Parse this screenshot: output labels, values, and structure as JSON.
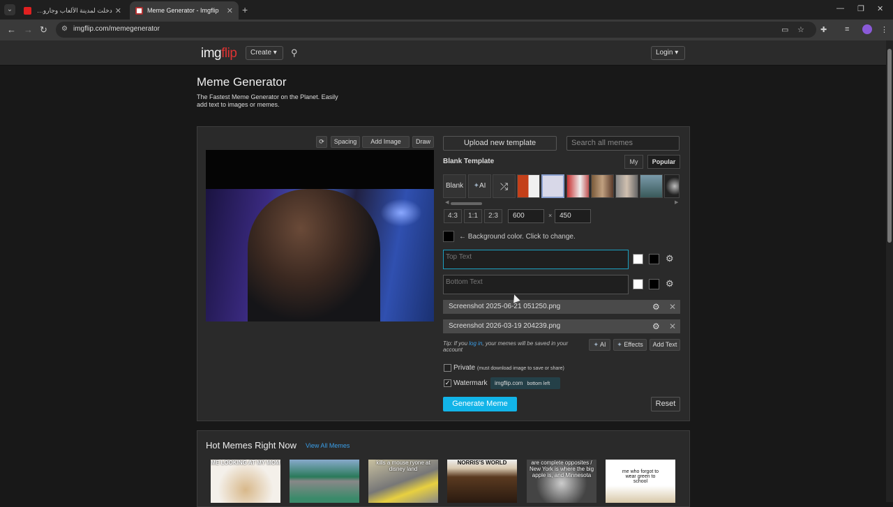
{
  "browser": {
    "tabs": [
      {
        "title": "دخلت لمدينة الألعاب وجارو ليا تتو..."
      },
      {
        "title": "Meme Generator - Imgflip"
      }
    ],
    "url": "imgflip.com/memegenerator"
  },
  "header": {
    "logo_main": "img",
    "logo_accent": "flip",
    "create_label": "Create ▾",
    "login_label": "Login ▾"
  },
  "page": {
    "title": "Meme Generator",
    "subtitle": "The Fastest Meme Generator on the Planet. Easily add text to images or memes."
  },
  "canvas_tools": {
    "spacing": "Spacing",
    "add_image": "Add Image",
    "draw": "Draw"
  },
  "templates": {
    "upload_label": "Upload new template",
    "search_placeholder": "Search all memes",
    "blank_template_label": "Blank Template",
    "tab_my": "My",
    "tab_popular": "Popular",
    "blank_thumb": "Blank",
    "ai_thumb": "AI"
  },
  "size": {
    "ratios": [
      "4:3",
      "1:1",
      "2:3"
    ],
    "width": "600",
    "height": "450",
    "x": "×"
  },
  "background": {
    "label": "← Background color. Click to change.",
    "color": "#000000"
  },
  "text_boxes": [
    {
      "placeholder": "Top Text"
    },
    {
      "placeholder": "Bottom Text"
    }
  ],
  "image_layers": [
    {
      "name": "Screenshot 2025-06-21 051250.png"
    },
    {
      "name": "Screenshot 2026-03-19 204239.png"
    }
  ],
  "tip": {
    "prefix": "Tip: If you ",
    "link": "log in",
    "suffix": ", your memes will be saved in your account"
  },
  "actions": {
    "ai": "AI",
    "effects": "Effects",
    "add_text": "Add Text"
  },
  "options": {
    "private_label": "Private",
    "private_note": "(must download image to save or share)",
    "private_checked": false,
    "watermark_label": "Watermark",
    "watermark_checked": true,
    "watermark_text": "imgflip.com",
    "watermark_position": "bottom left"
  },
  "buttons": {
    "generate": "Generate Meme",
    "reset": "Reset"
  },
  "hot": {
    "title": "Hot Memes Right Now",
    "view_all": "View All Memes",
    "thumb_texts": [
      "ME LOOKING AT MY MOM",
      "",
      "kills a mouse ryone at disney land",
      "NORRIS'S WORLD",
      "are complete opposites / New York is where the big apple is, and Minnesota",
      "me who forgot to wear green to school"
    ]
  },
  "colors": {
    "accent": "#12b4e8",
    "brand_red": "#dd3333",
    "panel": "#2a2a2a"
  }
}
